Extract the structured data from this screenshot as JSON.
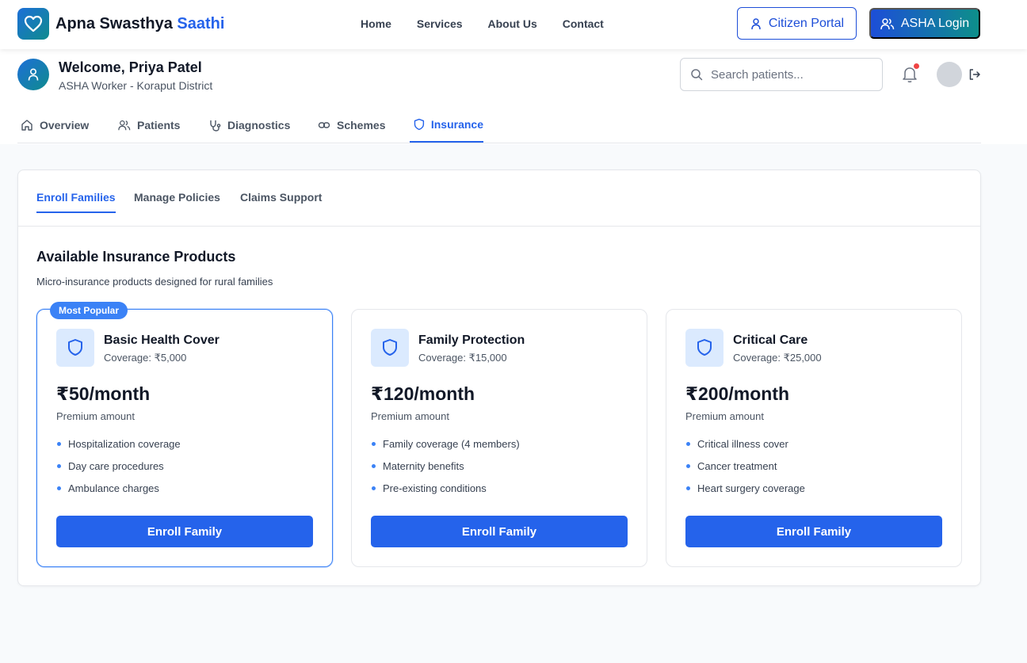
{
  "brand": {
    "name_main": "Apna Swasthya",
    "name_accent": "Saathi"
  },
  "nav": {
    "links": [
      "Home",
      "Services",
      "About Us",
      "Contact"
    ],
    "citizen_portal": "Citizen Portal",
    "asha_login": "ASHA Login"
  },
  "user": {
    "welcome": "Welcome, Priya Patel",
    "role": "ASHA Worker - Koraput District"
  },
  "search": {
    "placeholder": "Search patients..."
  },
  "tabs": [
    {
      "label": "Overview",
      "icon": "home-icon"
    },
    {
      "label": "Patients",
      "icon": "users-icon"
    },
    {
      "label": "Diagnostics",
      "icon": "stethoscope-icon"
    },
    {
      "label": "Schemes",
      "icon": "link-icon"
    },
    {
      "label": "Insurance",
      "icon": "shield-icon",
      "active": true
    }
  ],
  "subtabs": [
    {
      "label": "Enroll Families",
      "active": true
    },
    {
      "label": "Manage Policies"
    },
    {
      "label": "Claims Support"
    }
  ],
  "section": {
    "title": "Available Insurance Products",
    "subtitle": "Micro-insurance products designed for rural families"
  },
  "products": [
    {
      "badge": "Most Popular",
      "name": "Basic Health Cover",
      "coverage": "Coverage: ₹5,000",
      "price": "₹50/month",
      "price_label": "Premium amount",
      "features": [
        "Hospitalization coverage",
        "Day care procedures",
        "Ambulance charges"
      ],
      "button": "Enroll Family"
    },
    {
      "name": "Family Protection",
      "coverage": "Coverage: ₹15,000",
      "price": "₹120/month",
      "price_label": "Premium amount",
      "features": [
        "Family coverage (4 members)",
        "Maternity benefits",
        "Pre-existing conditions"
      ],
      "button": "Enroll Family"
    },
    {
      "name": "Critical Care",
      "coverage": "Coverage: ₹25,000",
      "price": "₹200/month",
      "price_label": "Premium amount",
      "features": [
        "Critical illness cover",
        "Cancer treatment",
        "Heart surgery coverage"
      ],
      "button": "Enroll Family"
    }
  ],
  "colors": {
    "primary": "#2563eb",
    "teal": "#0d8f8a",
    "notification": "#ef4444"
  }
}
